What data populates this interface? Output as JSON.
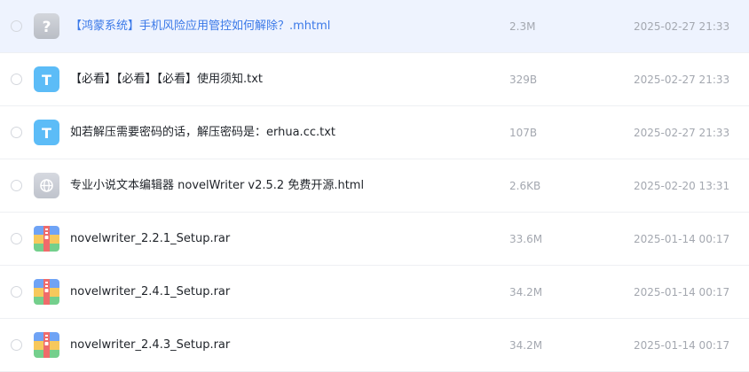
{
  "files": [
    {
      "name": "【鸿蒙系统】手机风险应用管控如何解除？.mhtml",
      "size": "2.3M",
      "date": "2025-02-27 21:33",
      "icon": "unknown-file-icon",
      "selected": true
    },
    {
      "name": "【必看】【必看】【必看】使用须知.txt",
      "size": "329B",
      "date": "2025-02-27 21:33",
      "icon": "text-file-icon",
      "icon_letter": "T",
      "selected": false
    },
    {
      "name": "如若解压需要密码的话，解压密码是：erhua.cc.txt",
      "size": "107B",
      "date": "2025-02-27 21:33",
      "icon": "text-file-icon",
      "icon_letter": "T",
      "selected": false
    },
    {
      "name": "专业小说文本编辑器 novelWriter v2.5.2 免费开源.html",
      "size": "2.6KB",
      "date": "2025-02-20 13:31",
      "icon": "web-file-icon",
      "selected": false
    },
    {
      "name": "novelwriter_2.2.1_Setup.rar",
      "size": "33.6M",
      "date": "2025-01-14 00:17",
      "icon": "archive-file-icon",
      "selected": false
    },
    {
      "name": "novelwriter_2.4.1_Setup.rar",
      "size": "34.2M",
      "date": "2025-01-14 00:17",
      "icon": "archive-file-icon",
      "selected": false
    },
    {
      "name": "novelwriter_2.4.3_Setup.rar",
      "size": "34.2M",
      "date": "2025-01-14 00:17",
      "icon": "archive-file-icon",
      "selected": false
    }
  ],
  "colors": {
    "selected_background": "#eef3fe",
    "selected_text": "#3b79e8",
    "text_icon": "#5cbcf7",
    "unknown_icon": "#c7cad1"
  }
}
